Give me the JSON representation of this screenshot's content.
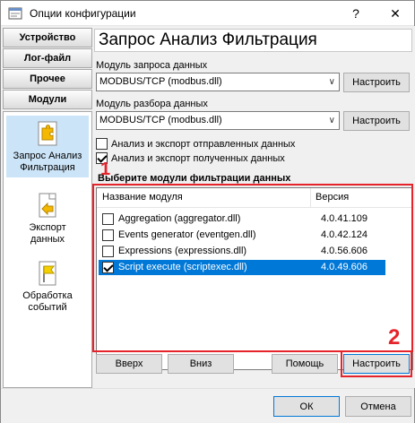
{
  "window": {
    "title": "Опции конфигурации",
    "help_glyph": "?",
    "close_glyph": "✕"
  },
  "sidebar": {
    "tabs": [
      "Устройство",
      "Лог-файл",
      "Прочее",
      "Модули"
    ],
    "items": [
      {
        "label_line1": "Запрос Анализ",
        "label_line2": "Фильтрация",
        "icon": "puzzle-icon",
        "selected": true
      },
      {
        "label_line1": "Экспорт",
        "label_line2": "данных",
        "icon": "export-icon",
        "selected": false
      },
      {
        "label_line1": "Обработка",
        "label_line2": "событий",
        "icon": "flag-icon",
        "selected": false
      }
    ]
  },
  "main": {
    "header": "Запрос Анализ Фильтрация",
    "request_module_label": "Модуль запроса данных",
    "request_module_value": "MODBUS/TCP (modbus.dll)",
    "parse_module_label": "Модуль разбора данных",
    "parse_module_value": "MODBUS/TCP (modbus.dll)",
    "configure_label": "Настроить",
    "checkbox_sent": "Анализ и экспорт отправленных данных",
    "checkbox_received": "Анализ и экспорт полученных данных",
    "filter_title": "Выберите модули фильтрации данных",
    "list": {
      "col_name": "Название модуля",
      "col_version": "Версия",
      "rows": [
        {
          "name": "Aggregation (aggregator.dll)",
          "version": "4.0.41.109",
          "checked": false,
          "selected": false
        },
        {
          "name": "Events generator (eventgen.dll)",
          "version": "4.0.42.124",
          "checked": false,
          "selected": false
        },
        {
          "name": "Expressions (expressions.dll)",
          "version": "4.0.56.606",
          "checked": false,
          "selected": false
        },
        {
          "name": "Script execute (scriptexec.dll)",
          "version": "4.0.49.606",
          "checked": true,
          "selected": true
        }
      ]
    },
    "btn_up": "Вверх",
    "btn_down": "Вниз",
    "btn_help": "Помощь",
    "btn_configure": "Настроить"
  },
  "callouts": {
    "one": "1",
    "two": "2"
  },
  "footer": {
    "ok": "ОК",
    "cancel": "Отмена"
  },
  "colors": {
    "accent": "#0078d7",
    "highlight": "#e5232b"
  }
}
